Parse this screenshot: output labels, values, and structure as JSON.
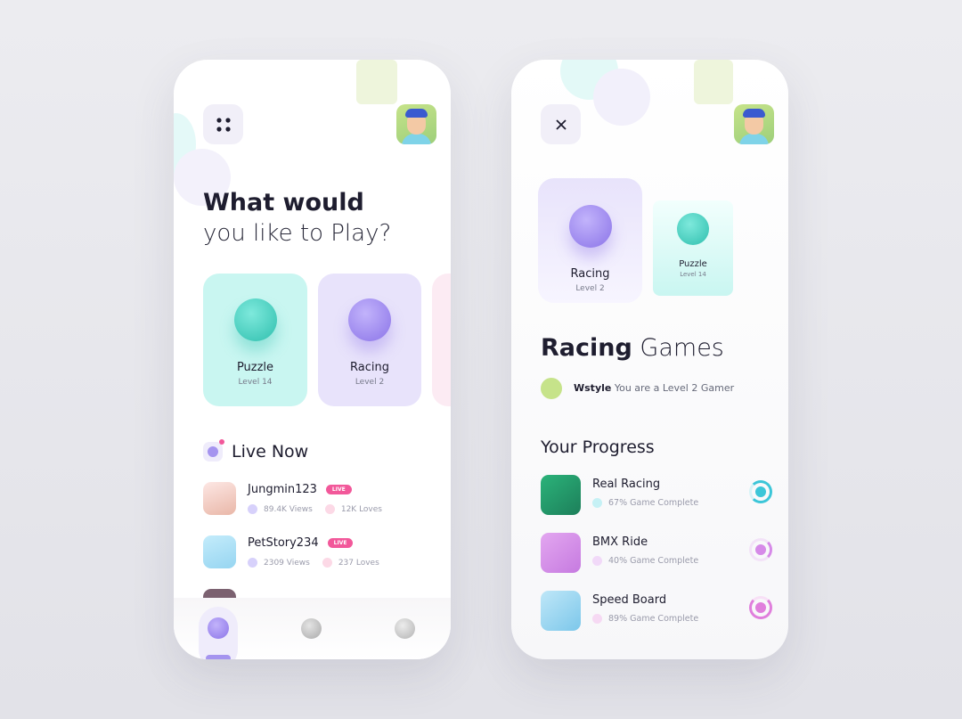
{
  "screen1": {
    "menu_icon": "grid-dots-icon",
    "title_bold": "What would",
    "title_light": "you like to Play?",
    "categories": [
      {
        "title": "Puzzle",
        "level": "Level 14",
        "color": "#c9f6f1"
      },
      {
        "title": "Racing",
        "level": "Level 2",
        "color": "#e8e3fb"
      }
    ],
    "live_title": "Live Now",
    "live_badge": "LIVE",
    "streams": [
      {
        "name": "Jungmin123",
        "views": "89.4K Views",
        "loves": "12K Loves"
      },
      {
        "name": "PetStory234",
        "views": "2309 Views",
        "loves": "237 Loves"
      }
    ],
    "nav": [
      "rocket-icon",
      "heart-icon",
      "puzzle-icon"
    ]
  },
  "screen2": {
    "close_icon": "close-icon",
    "cards": [
      {
        "title": "Racing",
        "level": "Level 2"
      },
      {
        "title": "Puzzle",
        "level": "Level 14"
      }
    ],
    "heading_bold": "Racing",
    "heading_light": "Games",
    "user_name": "Wstyle",
    "user_status": "You are a Level 2 Gamer",
    "progress_title": "Your Progress",
    "games": [
      {
        "name": "Real Racing",
        "progress": "67% Game Complete",
        "color": "#3cc6d8"
      },
      {
        "name": "BMX Ride",
        "progress": "40% Game Complete",
        "color": "#d68ae8"
      },
      {
        "name": "Speed Board",
        "progress": "89% Game Complete",
        "color": "#e07fdc"
      }
    ]
  },
  "colors": {
    "accent": "#8b74e8",
    "live": "#f2589a",
    "text": "#1e1d2f"
  }
}
